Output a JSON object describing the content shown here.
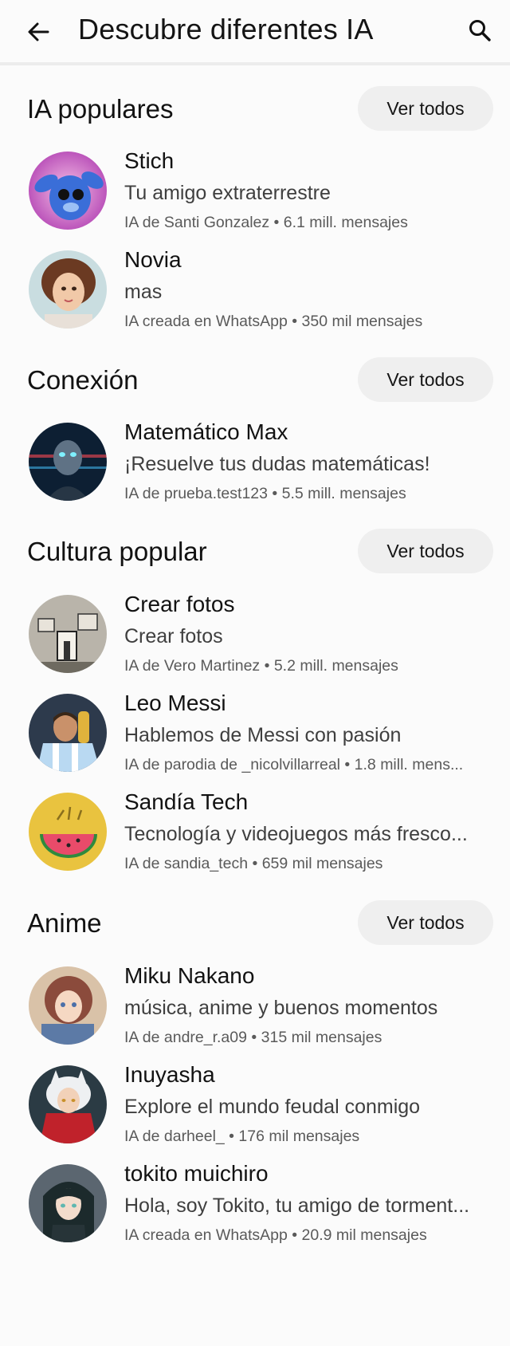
{
  "header": {
    "title": "Descubre diferentes IA",
    "back_icon": "arrow-left-icon",
    "search_icon": "search-icon"
  },
  "sections": [
    {
      "title": "IA populares",
      "see_all": "Ver todos",
      "items": [
        {
          "name": "Stich",
          "desc": "Tu amigo extraterrestre",
          "meta": "IA de Santi Gonzalez • 6.1 mill. mensajes"
        },
        {
          "name": "Novia",
          "desc": "mas",
          "meta": "IA creada en WhatsApp • 350 mil mensajes"
        }
      ]
    },
    {
      "title": "Conexión",
      "see_all": "Ver todos",
      "items": [
        {
          "name": "Matemático Max",
          "desc": "¡Resuelve tus dudas matemáticas!",
          "meta": "IA de prueba.test123 • 5.5 mill. mensajes"
        }
      ]
    },
    {
      "title": "Cultura popular",
      "see_all": "Ver todos",
      "items": [
        {
          "name": "Crear fotos",
          "desc": "Crear fotos",
          "meta": "IA de Vero Martinez • 5.2 mill. mensajes"
        },
        {
          "name": "Leo Messi",
          "desc": "Hablemos de Messi con pasión",
          "meta": "IA de parodia de _nicolvillarreal • 1.8 mill. mens..."
        },
        {
          "name": "Sandía Tech",
          "desc": "Tecnología y videojuegos más fresco...",
          "meta": "IA de sandia_tech • 659 mil mensajes"
        }
      ]
    },
    {
      "title": "Anime",
      "see_all": "Ver todos",
      "items": [
        {
          "name": "Miku Nakano",
          "desc": "música, anime y buenos momentos",
          "meta": "IA de andre_r.a09 • 315 mil mensajes"
        },
        {
          "name": "Inuyasha",
          "desc": "Explore el mundo feudal conmigo",
          "meta": "IA de darheel_ • 176 mil mensajes"
        },
        {
          "name": "tokito muichiro",
          "desc": "Hola, soy Tokito, tu amigo de torment...",
          "meta": "IA creada en WhatsApp • 20.9 mil mensajes"
        }
      ]
    }
  ]
}
